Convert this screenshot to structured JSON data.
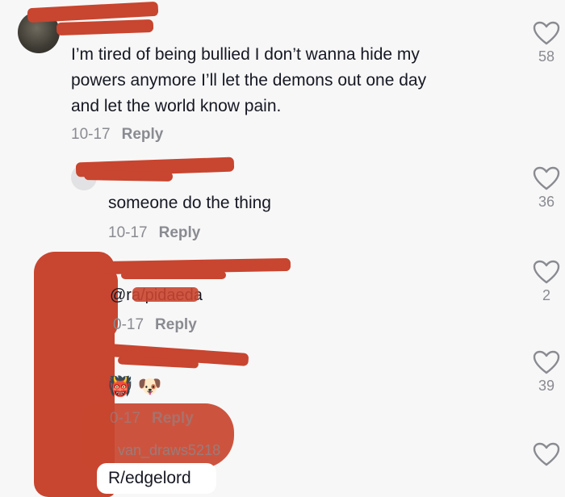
{
  "comments": [
    {
      "text": "I’m tired of being bullied I don’t wanna hide my powers anymore I’ll let the demons out one day and let the world know pain.",
      "line1": "I’m tired of being bullied I don’t wanna hide my",
      "line2": "powers anymore I’ll let the demons out one day",
      "line3": "and let the world know pain.",
      "date": "10-17",
      "reply_label": "Reply",
      "likes": "58"
    },
    {
      "text": "someone do the thing",
      "date": "10-17",
      "reply_label": "Reply",
      "likes": "36"
    },
    {
      "username": "@ra/pidaeda",
      "date": "0-17",
      "reply_label": "Reply",
      "likes": "2"
    },
    {
      "emojis": "👹 🐶",
      "date": "0-17",
      "reply_label": "Reply",
      "likes": "39"
    },
    {
      "username": "van_draws5218",
      "text": "R/edgelord"
    }
  ],
  "colors": {
    "redaction": "#c8452f",
    "muted": "#8a8b91",
    "text": "#161823",
    "background": "#f7f7f7"
  }
}
